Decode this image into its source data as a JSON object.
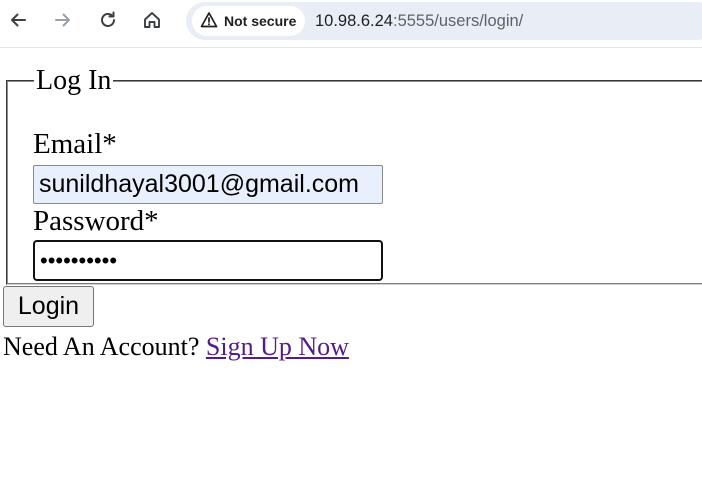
{
  "browser": {
    "security_label": "Not secure",
    "url_host": "10.98.6.24",
    "url_path": ":5555/users/login/"
  },
  "form": {
    "legend": "Log In",
    "email_label": "Email*",
    "email_value": "sunildhayal3001@gmail.com",
    "password_label": "Password*",
    "password_masked": "••••••••••",
    "login_button": "Login"
  },
  "signup": {
    "prompt": "Need An Account?",
    "link_text": "Sign Up Now"
  },
  "colors": {
    "omnibox_bg": "#e9eef6",
    "autofill_bg": "#e8f0fe",
    "visited_link": "#551a8b"
  }
}
